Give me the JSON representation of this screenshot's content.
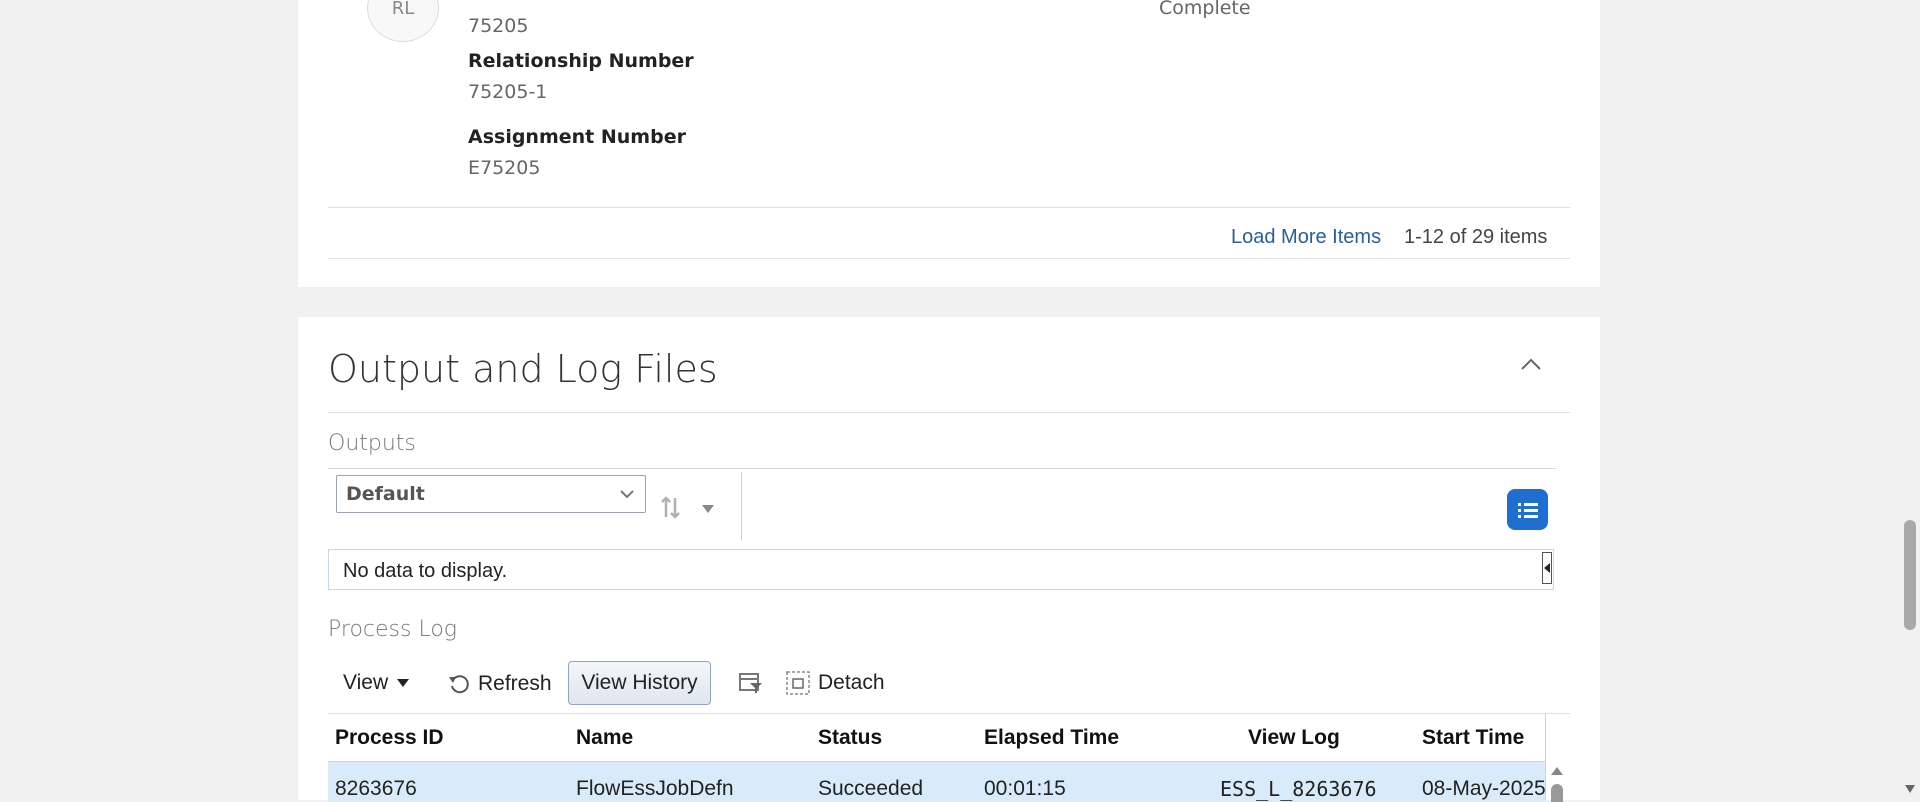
{
  "person": {
    "avatar_initials": "RL",
    "person_number_value": "75205",
    "status_value": "Complete",
    "relationship_label": "Relationship Number",
    "relationship_value": "75205-1",
    "assignment_label": "Assignment Number",
    "assignment_value": "E75205"
  },
  "pagination": {
    "load_more": "Load More Items",
    "range_text": "1-12 of 29 items"
  },
  "output_section": {
    "title": "Output and Log Files",
    "outputs_label": "Outputs",
    "view_select_value": "Default",
    "empty_text": "No data to display."
  },
  "process_log": {
    "label": "Process Log",
    "toolbar": {
      "view": "View",
      "refresh": "Refresh",
      "view_history": "View History",
      "detach": "Detach"
    },
    "columns": [
      "Process ID",
      "Name",
      "Status",
      "Elapsed Time",
      "View Log",
      "Start Time"
    ],
    "rows": [
      [
        "8263676",
        "FlowEssJobDefn",
        "Succeeded",
        "00:01:15",
        "ESS_L_8263676",
        "08-May-2025"
      ]
    ]
  },
  "colors": {
    "accent": "#1f6fd1",
    "link": "#2a5d9b",
    "selected_row": "#d9ebfb"
  },
  "icons": [
    "chevron-up-icon",
    "chevron-down-icon",
    "sort-icon",
    "list-view-icon",
    "refresh-icon",
    "filter-icon",
    "detach-icon",
    "collapse-left-icon"
  ]
}
